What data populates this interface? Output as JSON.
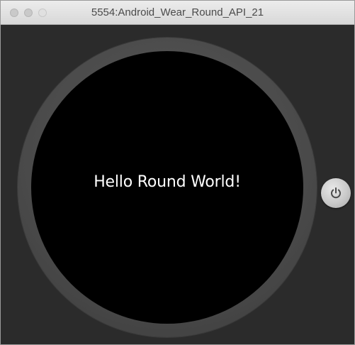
{
  "window": {
    "title": "5554:Android_Wear_Round_API_21"
  },
  "watch": {
    "screen_text": "Hello Round World!"
  },
  "controls": {
    "power_icon": "power-icon"
  },
  "colors": {
    "background": "#2b2b2b",
    "bezel": "#4a4a4a",
    "screen": "#000000",
    "text": "#ffffff"
  }
}
